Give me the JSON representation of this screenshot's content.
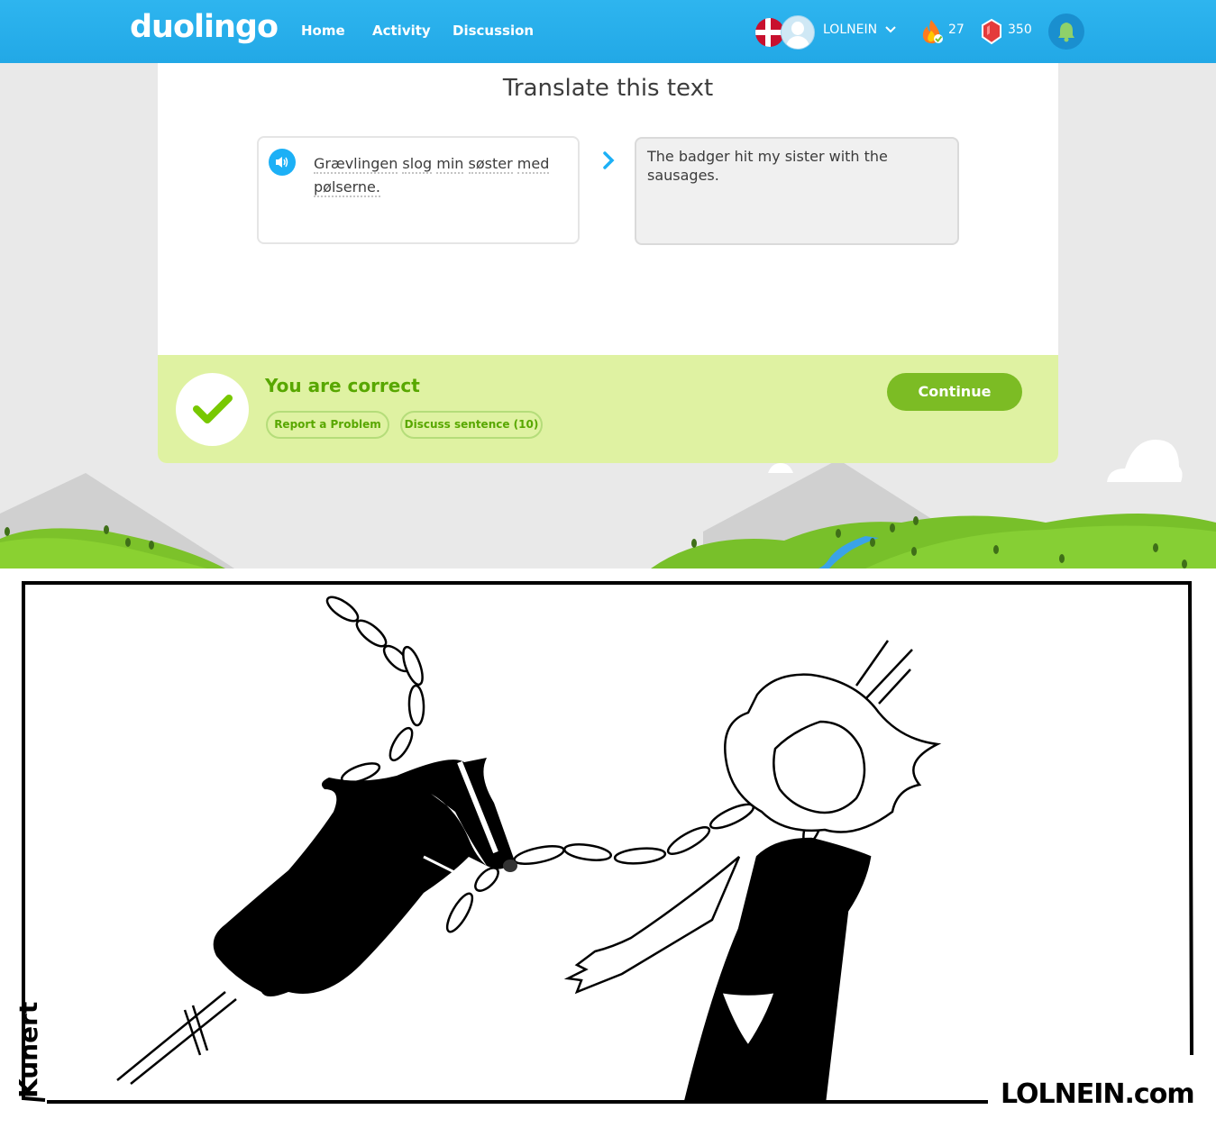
{
  "navbar": {
    "logo": "duolingo",
    "links": [
      "Home",
      "Activity",
      "Discussion"
    ],
    "username": "LOLNEIN",
    "streak": "27",
    "gems": "350",
    "flag_icon": "denmark-flag-icon",
    "streak_icon": "flame-icon",
    "gem_icon": "gem-icon",
    "bell_icon": "bell-icon",
    "colors": {
      "navbar": "#22a8e6"
    }
  },
  "exercise": {
    "prompt": "Translate this text",
    "source_words": [
      "Grævlingen",
      "slog",
      "min",
      "søster",
      "med",
      "pølserne."
    ],
    "answer": "The badger hit my sister with the sausages."
  },
  "result": {
    "title": "You are correct",
    "report_label": "Report a Problem",
    "discuss_label": "Discuss sentence (10)",
    "continue_label": "Continue",
    "colors": {
      "bar": "#dff2a2",
      "text": "#58a700",
      "button": "#7cbc24"
    }
  },
  "comic": {
    "artist": "Kunert",
    "site": "LOLNEIN.com"
  }
}
